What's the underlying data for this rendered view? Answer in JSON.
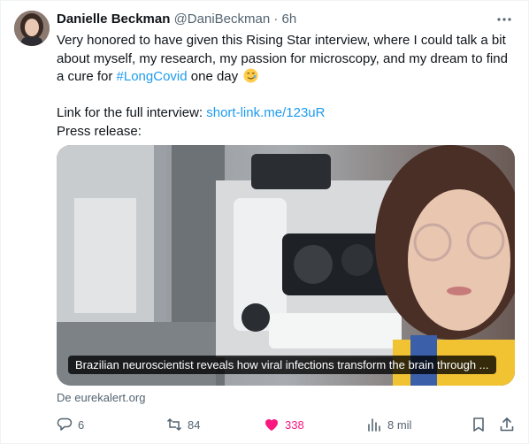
{
  "tweet": {
    "display_name": "Danielle Beckman",
    "handle": "@DaniBeckman",
    "separator": "·",
    "time": "6h",
    "text_line1": "Very honored to have given this Rising Star interview, where I could talk a bit about myself, my research, my passion for microscopy, and my dream to find a cure for ",
    "hashtag": "#LongCovid",
    "text_line1_end": " one day",
    "link_label": "Link for the full interview: ",
    "link_url": "short-link.me/123uR",
    "press_release": "Press release:"
  },
  "card": {
    "caption": "Brazilian neuroscientist reveals how viral infections transform the brain through ...",
    "source": "De eurekalert.org"
  },
  "actions": {
    "replies": "6",
    "reposts": "84",
    "likes": "338",
    "views": "8 mil"
  },
  "colors": {
    "link": "#1d9bf0",
    "like": "#f91880",
    "muted": "#536471"
  },
  "icons": [
    "more-icon",
    "smiling-tear-emoji",
    "reply-icon",
    "repost-icon",
    "heart-icon",
    "views-icon",
    "bookmark-icon",
    "share-icon"
  ]
}
